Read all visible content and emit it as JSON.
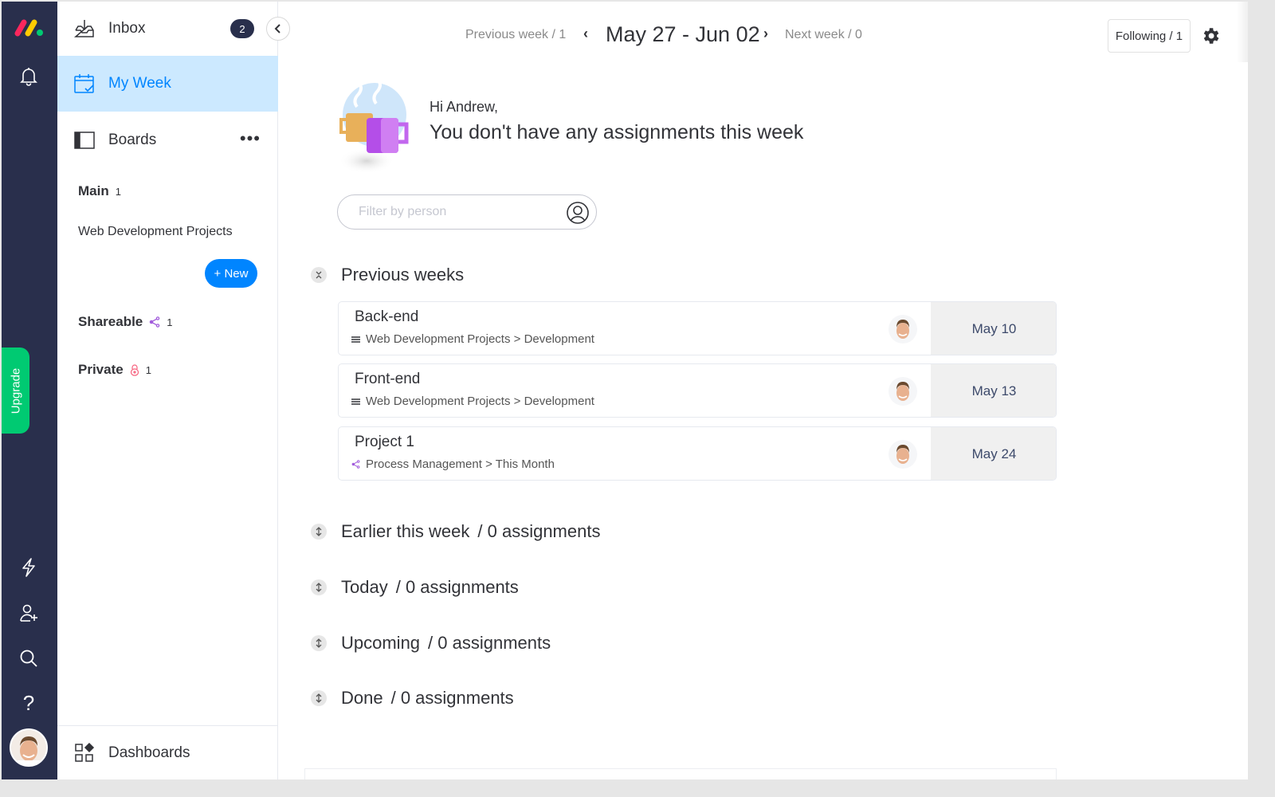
{
  "rail": {
    "icons": [
      "monday-logo",
      "bell-icon",
      "lightning-icon",
      "invite-user-icon",
      "search-icon",
      "help-icon",
      "user-avatar"
    ],
    "upgrade_label": "Upgrade",
    "colors": {
      "background": "#292f4c",
      "upgrade": "#00ca72"
    }
  },
  "sidebar": {
    "inbox": {
      "label": "Inbox",
      "badge": "2"
    },
    "my_week": {
      "label": "My Week"
    },
    "boards": {
      "label": "Boards",
      "more": "•••"
    },
    "workspaces": [
      {
        "name": "Main",
        "count": "1"
      },
      {
        "name": "Shareable",
        "count": "1",
        "icon": "share-icon"
      },
      {
        "name": "Private",
        "count": "1",
        "icon": "lock-icon"
      }
    ],
    "boards_list": [
      "Web Development Projects"
    ],
    "new_button": "+ New",
    "dashboards": {
      "label": "Dashboards"
    },
    "accent": "#0085ff"
  },
  "header": {
    "previous_week": "Previous week / 1",
    "range": "May 27 - Jun 02",
    "next_week": "Next week / 0",
    "following": "Following / 1"
  },
  "greeting": {
    "hi": "Hi Andrew,",
    "message": "You don't have any assignments this week"
  },
  "filter": {
    "placeholder": "Filter by person",
    "value": ""
  },
  "previous_weeks": {
    "title": "Previous weeks",
    "items": [
      {
        "title": "Back-end",
        "path": "Web Development Projects > Development",
        "path_icon": "board-icon",
        "date": "May 10"
      },
      {
        "title": "Front-end",
        "path": "Web Development Projects > Development",
        "path_icon": "board-icon",
        "date": "May 13"
      },
      {
        "title": "Project 1",
        "path": "Process Management > This Month",
        "path_icon": "share-icon",
        "date": "May 24"
      }
    ]
  },
  "sections": [
    {
      "title": "Earlier this week",
      "count": "/ 0 assignments"
    },
    {
      "title": "Today",
      "count": "/ 0 assignments"
    },
    {
      "title": "Upcoming",
      "count": "/ 0 assignments"
    },
    {
      "title": "Done",
      "count": "/ 0 assignments"
    }
  ]
}
